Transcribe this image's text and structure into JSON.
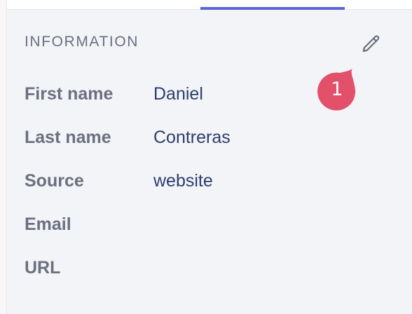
{
  "section": {
    "title": "INFORMATION",
    "edit_icon": "pencil-icon"
  },
  "fields": [
    {
      "label": "First name",
      "value": "Daniel"
    },
    {
      "label": "Last name",
      "value": "Contreras"
    },
    {
      "label": "Source",
      "value": "website"
    },
    {
      "label": "Email",
      "value": ""
    },
    {
      "label": "URL",
      "value": ""
    }
  ],
  "badge": {
    "number": "1",
    "color": "#e2506a"
  },
  "colors": {
    "accent": "#5a67d8",
    "label": "#6b7080",
    "value": "#2c3e70",
    "panel_bg": "#f3f4f7"
  }
}
